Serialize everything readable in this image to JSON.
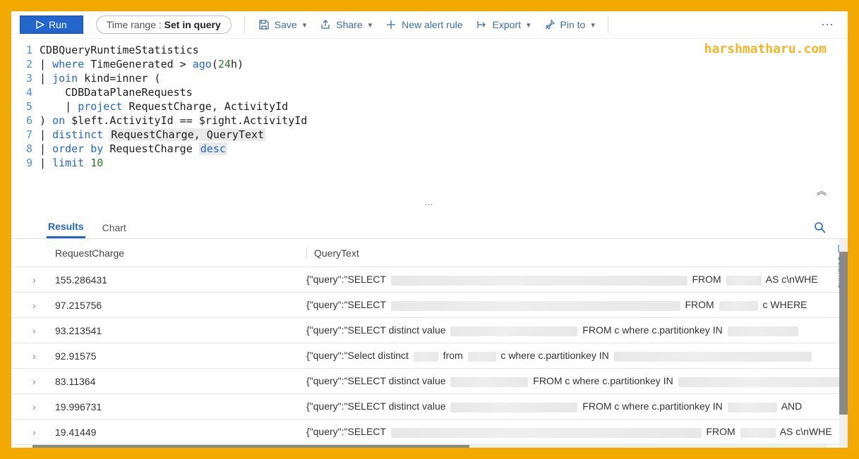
{
  "watermark": "harshmatharu.com",
  "toolbar": {
    "run_label": "Run",
    "timerange_prefix": "Time range : ",
    "timerange_value": "Set in query",
    "save_label": "Save",
    "share_label": "Share",
    "new_alert_label": "New alert rule",
    "export_label": "Export",
    "pin_label": "Pin to"
  },
  "editor": {
    "lines": [
      {
        "n": "1",
        "tokens": [
          [
            "CDBQueryRuntimeStatistics",
            "black"
          ]
        ]
      },
      {
        "n": "2",
        "tokens": [
          [
            "| ",
            "black"
          ],
          [
            "where ",
            "blue"
          ],
          [
            "TimeGenerated > ",
            "black"
          ],
          [
            "ago",
            "blue"
          ],
          [
            "(",
            "black"
          ],
          [
            "24",
            "green"
          ],
          [
            "h)",
            "black"
          ]
        ]
      },
      {
        "n": "3",
        "tokens": [
          [
            "| ",
            "black"
          ],
          [
            "join ",
            "blue"
          ],
          [
            "kind=inner (",
            "black"
          ]
        ]
      },
      {
        "n": "4",
        "tokens": [
          [
            "    CDBDataPlaneRequests",
            "black"
          ]
        ]
      },
      {
        "n": "5",
        "tokens": [
          [
            "    | ",
            "black"
          ],
          [
            "project ",
            "blue"
          ],
          [
            "RequestCharge, ActivityId",
            "black"
          ]
        ]
      },
      {
        "n": "6",
        "tokens": [
          [
            ") ",
            "black"
          ],
          [
            "on ",
            "blue"
          ],
          [
            "$left.ActivityId == $right.ActivityId",
            "black"
          ]
        ]
      },
      {
        "n": "7",
        "tokens": [
          [
            "| ",
            "black"
          ],
          [
            "distinct ",
            "blue"
          ],
          [
            "RequestCharge, QueryText",
            "hl"
          ]
        ]
      },
      {
        "n": "8",
        "tokens": [
          [
            "| ",
            "black"
          ],
          [
            "order by ",
            "blue"
          ],
          [
            "RequestCharge ",
            "black"
          ],
          [
            "desc",
            "hl-blue"
          ]
        ]
      },
      {
        "n": "9",
        "tokens": [
          [
            "| ",
            "black"
          ],
          [
            "limit ",
            "blue"
          ],
          [
            "10",
            "green"
          ]
        ]
      }
    ]
  },
  "tabs": {
    "results": "Results",
    "chart": "Chart",
    "columns_label": "Columns"
  },
  "grid": {
    "columns": {
      "request_charge": "RequestCharge",
      "query_text": "QueryText"
    },
    "rows": [
      {
        "rc": "155.286431",
        "qt_pre": "{\"query\":\"SELECT ",
        "qt_mid": "FROM ",
        "qt_suf": " AS c\\nWHE",
        "b1": 420,
        "b2": 50
      },
      {
        "rc": "97.215756",
        "qt_pre": "{\"query\":\"SELECT ",
        "qt_mid": "FROM ",
        "qt_suf": " c WHERE ",
        "b1": 410,
        "b2": 55
      },
      {
        "rc": "93.213541",
        "qt_pre": "{\"query\":\"SELECT distinct value ",
        "qt_mid": "FROM c where c.partitionkey IN ",
        "qt_suf": "",
        "b1": 180,
        "b2": 100
      },
      {
        "rc": "92.91575",
        "qt_pre": "{\"query\":\"Select distinct ",
        "qt_mid": "from ",
        "qt_mid2": " c where c.partitionkey IN ",
        "qt_suf": "",
        "b1": 35,
        "b2": 40,
        "b3": 280
      },
      {
        "rc": "83.11364",
        "qt_pre": "{\"query\":\"SELECT distinct value ",
        "qt_mid": "FROM c where c.partitionkey IN ",
        "qt_suf": "",
        "b1": 110,
        "b2": 260
      },
      {
        "rc": "19.996731",
        "qt_pre": "{\"query\":\"SELECT distinct value ",
        "qt_mid": "FROM c where c.partitionkey IN ",
        "qt_suf": " AND ",
        "b1": 180,
        "b2": 70
      },
      {
        "rc": "19.41449",
        "qt_pre": "{\"query\":\"SELECT ",
        "qt_mid": "FROM ",
        "qt_suf": " AS c\\nWHE",
        "b1": 440,
        "b2": 50
      }
    ]
  }
}
